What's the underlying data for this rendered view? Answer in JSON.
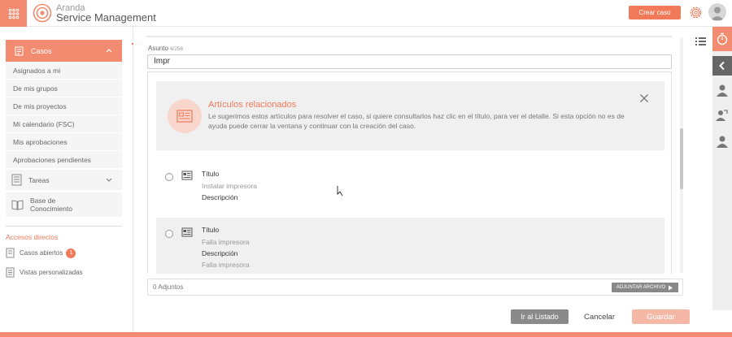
{
  "header": {
    "brand_top": "Aranda",
    "brand_bottom": "Service Management",
    "create_case": "Crear caso"
  },
  "sidebar": {
    "casos": "Casos",
    "items": [
      "Asignados a mi",
      "De mis grupos",
      "De mis proyectos",
      "Mi calendario (FSC)",
      "Mis aprobaciones",
      "Aprobaciones pendientes"
    ],
    "tareas": "Tareas",
    "knowledge_line1": "Base de",
    "knowledge_line2": "Conocimiento",
    "shortcuts_title": "Accesos directos",
    "open_cases": "Casos abiertos",
    "open_cases_count": "1",
    "custom_views": "Vistas personalizadas"
  },
  "form": {
    "subject_label": "Asunto",
    "subject_count": "4/256",
    "subject_value": "Impr"
  },
  "related": {
    "title": "Artículos relacionados",
    "text": "Le sugerimos estos artículos para resolver el caso, si quiere consultarlos haz clic en el título, para ver el detalle. Si esta opción no es de ayuda puede cerrar la ventana y continuar con la creación del caso."
  },
  "results": [
    {
      "title_label": "Título",
      "title_value": "Instalar impresora",
      "desc_label": "Descripción",
      "desc_value": ""
    },
    {
      "title_label": "Título",
      "title_value": "Falla impresora",
      "desc_label": "Descripción",
      "desc_value": "Falla impresora"
    }
  ],
  "attachments": {
    "label": "0 Adjuntos",
    "button": "ADJUNTAR ARCHIVO"
  },
  "actions": {
    "list": "Ir al Listado",
    "cancel": "Cancelar",
    "save": "Guardar"
  },
  "colors": {
    "accent": "#f28b6f",
    "accent_dark": "#f07a5a",
    "panel": "#f0f0f0"
  }
}
